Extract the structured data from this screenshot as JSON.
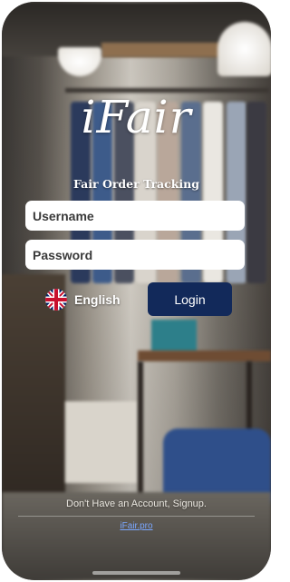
{
  "brand": {
    "logo": "iFair",
    "tagline": "Fair Order Tracking"
  },
  "form": {
    "username_placeholder": "Username",
    "password_placeholder": "Password",
    "login_label": "Login"
  },
  "language": {
    "label": "English",
    "flag_icon": "uk-flag-icon"
  },
  "footer": {
    "signup_text": "Don't Have an Account, Signup.",
    "site_link": "iFair.pro"
  },
  "colors": {
    "login_button": "#12295a",
    "link": "#7aa6ff",
    "text": "#ffffff"
  }
}
